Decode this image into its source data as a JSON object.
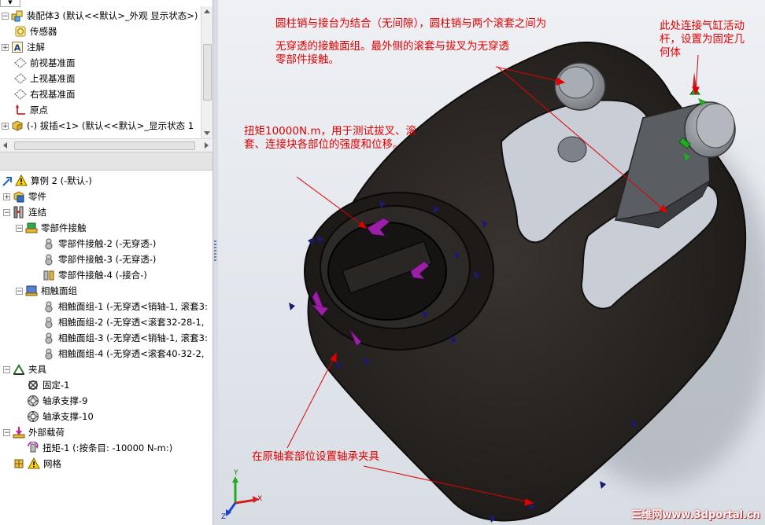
{
  "tree_top": {
    "combo_arrow": "▼",
    "items": [
      {
        "label": "装配体3 (默认<<默认>_外观 显示状态>)",
        "icon": "assembly-icon"
      },
      {
        "label": "传感器",
        "icon": "sensor-icon"
      },
      {
        "label": "注解",
        "icon": "annotation-icon"
      },
      {
        "label": "前视基准面",
        "icon": "plane-icon"
      },
      {
        "label": "上视基准面",
        "icon": "plane-icon"
      },
      {
        "label": "右视基准面",
        "icon": "plane-icon"
      },
      {
        "label": "原点",
        "icon": "origin-icon"
      },
      {
        "label": "(-) 拔插<1> (默认<<默认>_显示状态 1",
        "icon": "part-icon"
      }
    ]
  },
  "tree_sim": {
    "study": {
      "label": "算例 2 (-默认-)",
      "icon": "study-warning-icon"
    },
    "parts": {
      "label": "零件",
      "icon": "parts-icon"
    },
    "connections": {
      "label": "连结",
      "icon": "connections-icon"
    },
    "component_contact": {
      "label": "零部件接触",
      "icon": "component-contact-icon"
    },
    "contacts": [
      {
        "label": "零部件接触-2 (-无穿透-)",
        "icon": "contact-icon"
      },
      {
        "label": "零部件接触-3 (-无穿透-)",
        "icon": "contact-icon"
      },
      {
        "label": "零部件接触-4 (-接合-)",
        "icon": "bonded-icon"
      }
    ],
    "contact_sets": {
      "label": "相触面组",
      "icon": "contact-set-folder-icon"
    },
    "sets": [
      {
        "label": "相触面组-1 (-无穿透<销轴-1, 滚套3:",
        "icon": "contact-icon"
      },
      {
        "label": "相触面组-2 (-无穿透<滚套32-28-1,",
        "icon": "contact-icon"
      },
      {
        "label": "相触面组-3 (-无穿透<销轴-1, 滚套3:",
        "icon": "contact-icon"
      },
      {
        "label": "相触面组-4 (-无穿透<滚套40-32-2,",
        "icon": "contact-icon"
      }
    ],
    "fixtures": {
      "label": "夹具",
      "icon": "fixtures-icon"
    },
    "fixture_items": [
      {
        "label": "固定-1",
        "icon": "fixed-icon"
      },
      {
        "label": "轴承支撑-9",
        "icon": "bearing-icon"
      },
      {
        "label": "轴承支撑-10",
        "icon": "bearing-icon"
      }
    ],
    "loads": {
      "label": "外部载荷",
      "icon": "loads-icon"
    },
    "load_items": [
      {
        "label": "扭矩-1 (:按条目: -10000 N-m:)",
        "icon": "torque-icon"
      }
    ],
    "mesh": {
      "label": "网格",
      "icon": "mesh-warning-icon"
    }
  },
  "annotations": {
    "a1_line1": "圆柱销与接台为结合（无间隙），圆柱销与两个滚套之间为",
    "a1_line2": "无穿透的接触面组。最外侧的滚套与拔叉为无穿透",
    "a1_line3": "零部件接触。",
    "a2_line1": "此处连接气缸活动",
    "a2_line2": "杆，设置为固定几",
    "a2_line3": "何体",
    "a3_line1": "扭矩10000N.m，用于测试拔叉、滚",
    "a3_line2": "套、连接块各部位的强度和位移。",
    "a4": "在原轴套部位设置轴承夹具"
  },
  "watermark": "三维网www.3dportal.cn",
  "triad": {
    "x": "X",
    "y": "Y",
    "z": "Z"
  },
  "colors": {
    "annotation": "#e00000",
    "model": "#2a2622",
    "arrow_load": "#9b1fa8",
    "arrow_fixture": "#1a1a6e",
    "fixed_green": "#22aa22"
  }
}
